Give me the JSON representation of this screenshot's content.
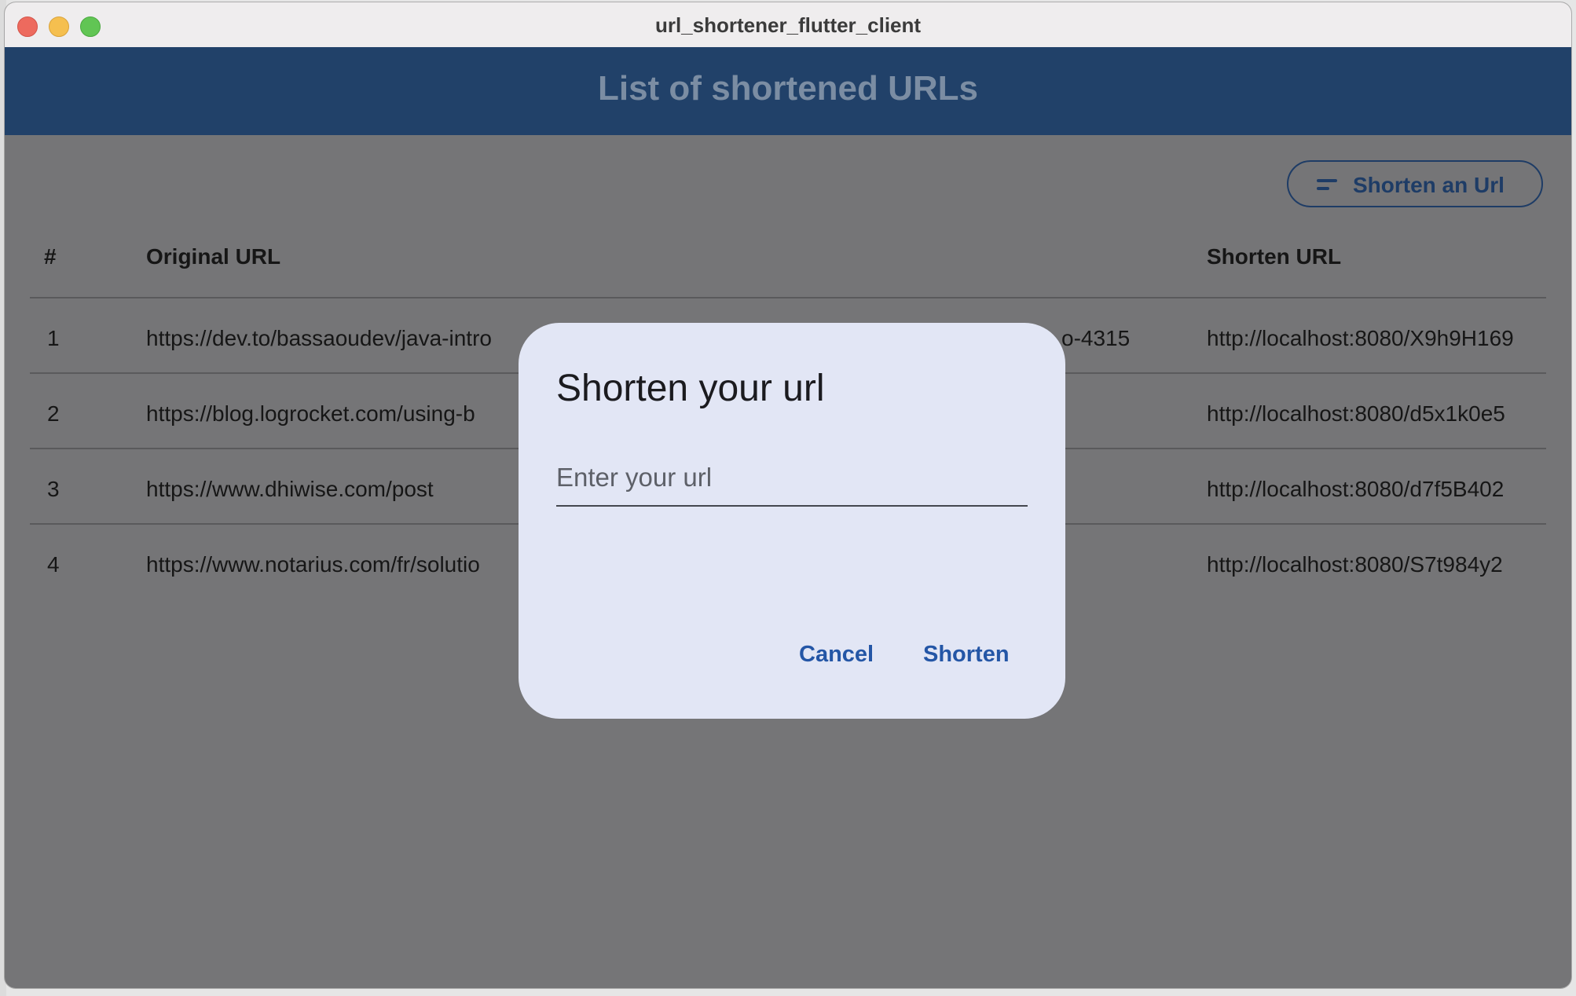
{
  "window": {
    "title": "url_shortener_flutter_client"
  },
  "appbar": {
    "title": "List of shortened URLs"
  },
  "toolbar": {
    "shorten_button_label": "Shorten an Url",
    "shorten_button_icon": "short-text-icon"
  },
  "table": {
    "headers": {
      "index": "#",
      "original": "Original URL",
      "shortened": "Shorten URL"
    },
    "rows": [
      {
        "index": "1",
        "original_left": "https://dev.to/bassaoudev/java-intro",
        "original_right": "o-4315",
        "short": "http://localhost:8080/X9h9H169"
      },
      {
        "index": "2",
        "original_left": "https://blog.logrocket.com/using-b",
        "original_right": "",
        "short": "http://localhost:8080/d5x1k0e5"
      },
      {
        "index": "3",
        "original_left": "https://www.dhiwise.com/post",
        "original_right": "",
        "short": "http://localhost:8080/d7f5B402"
      },
      {
        "index": "4",
        "original_left": "https://www.notarius.com/fr/solutio",
        "original_right": "",
        "short": "http://localhost:8080/S7t984y2"
      }
    ]
  },
  "dialog": {
    "title": "Shorten your url",
    "input_placeholder": "Enter your url",
    "input_value": "",
    "cancel_label": "Cancel",
    "confirm_label": "Shorten"
  },
  "colors": {
    "appbar": "#214169",
    "scrim_background": "#757577",
    "dialog_background": "#e2e6f5",
    "accent": "#2456a6"
  }
}
